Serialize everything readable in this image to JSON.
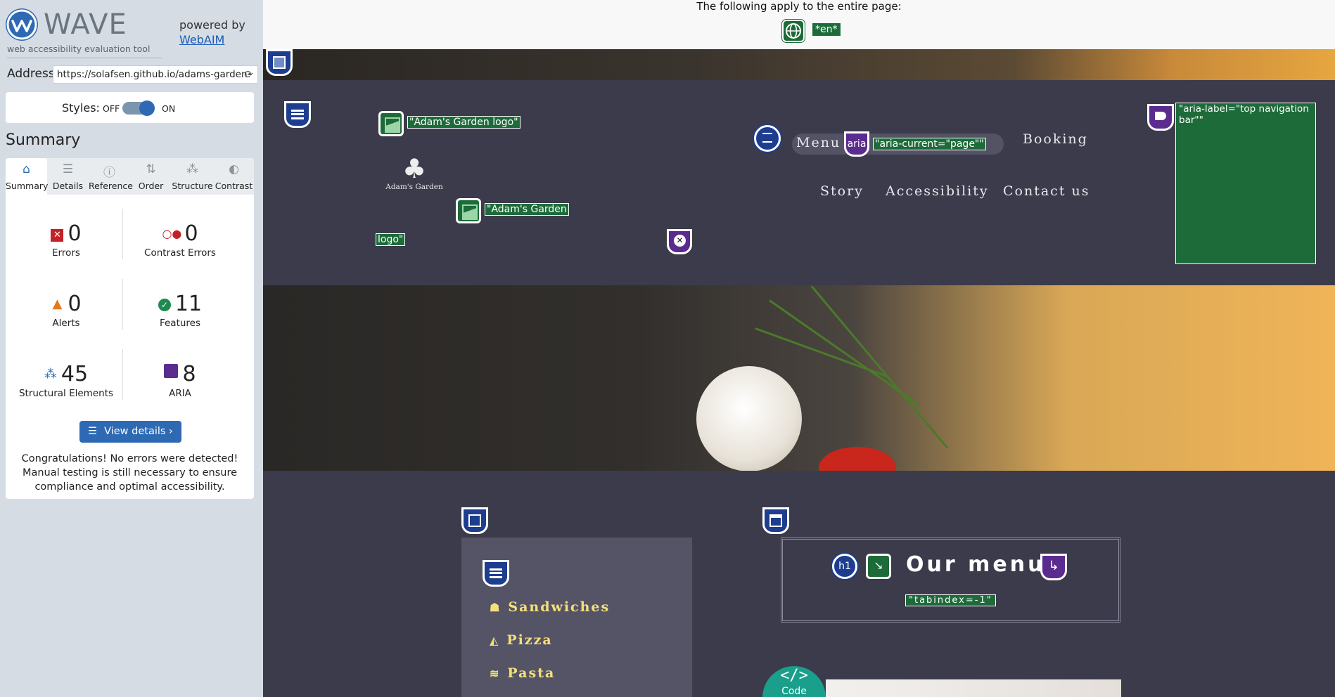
{
  "sidebar": {
    "brand": "WAVE",
    "tagline": "web accessibility evaluation tool",
    "powered_by": "powered by",
    "powered_link": "WebAIM",
    "address_label": "Address:",
    "address_value": "https://solafsen.github.io/adams-garden-",
    "styles_label": "Styles:",
    "styles_off": "OFF",
    "styles_on": "ON",
    "summary_title": "Summary",
    "tabs": [
      {
        "label": "Summary",
        "icon": "home-icon",
        "active": true
      },
      {
        "label": "Details",
        "icon": "list-icon",
        "active": false
      },
      {
        "label": "Reference",
        "icon": "info-icon",
        "active": false
      },
      {
        "label": "Order",
        "icon": "order-icon",
        "active": false
      },
      {
        "label": "Structure",
        "icon": "structure-icon",
        "active": false
      },
      {
        "label": "Contrast",
        "icon": "contrast-icon",
        "active": false
      }
    ],
    "stats": {
      "errors": {
        "value": "0",
        "label": "Errors",
        "color": "#c42127"
      },
      "contrast_errors": {
        "value": "0",
        "label": "Contrast Errors",
        "color": "#c42127"
      },
      "alerts": {
        "value": "0",
        "label": "Alerts",
        "color": "#e57a1d"
      },
      "features": {
        "value": "11",
        "label": "Features",
        "color": "#1e8a4f"
      },
      "structural": {
        "value": "45",
        "label": "Structural Elements",
        "color": "#2e6ab3"
      },
      "aria": {
        "value": "8",
        "label": "ARIA",
        "color": "#5b2c8f"
      }
    },
    "view_details": "View details ›",
    "congrats": "Congratulations! No errors were detected! Manual testing is still necessary to ensure compliance and optimal accessibility."
  },
  "page": {
    "notes_title": "The following apply to the entire page:",
    "lang_tag": "*en*",
    "logo_label_1": "\"Adam's Garden logo\"",
    "logo_label_2": "\"Adam's Garden",
    "logo_label_3": "logo\"",
    "logo_text": "Adam's Garden",
    "nav": {
      "menu": "Menu",
      "aria_badge": "aria",
      "aria_current": "\"aria-current=\"page\"\"",
      "booking": "Booking",
      "story": "Story",
      "accessibility": "Accessibility",
      "contact": "Contact us",
      "aria_label": "\"aria-label=\"top navigation bar\"\""
    },
    "food_menu": [
      {
        "label": "Sandwiches",
        "icon": "sandwich-icon"
      },
      {
        "label": "Pizza",
        "icon": "pizza-icon"
      },
      {
        "label": "Pasta",
        "icon": "pasta-icon"
      }
    ],
    "heading": "Our menu",
    "h1_badge": "h1",
    "tabindex_label": "\"tabindex=-1\"",
    "code_label": "Code",
    "code_glyph": "</>"
  },
  "colors": {
    "wave_blue": "#2e6ab3",
    "feature_green": "#1e6b3a",
    "aria_purple": "#5b2c8f",
    "structure_navy": "#1d3d8f",
    "link_yellow": "#f3e07a"
  }
}
